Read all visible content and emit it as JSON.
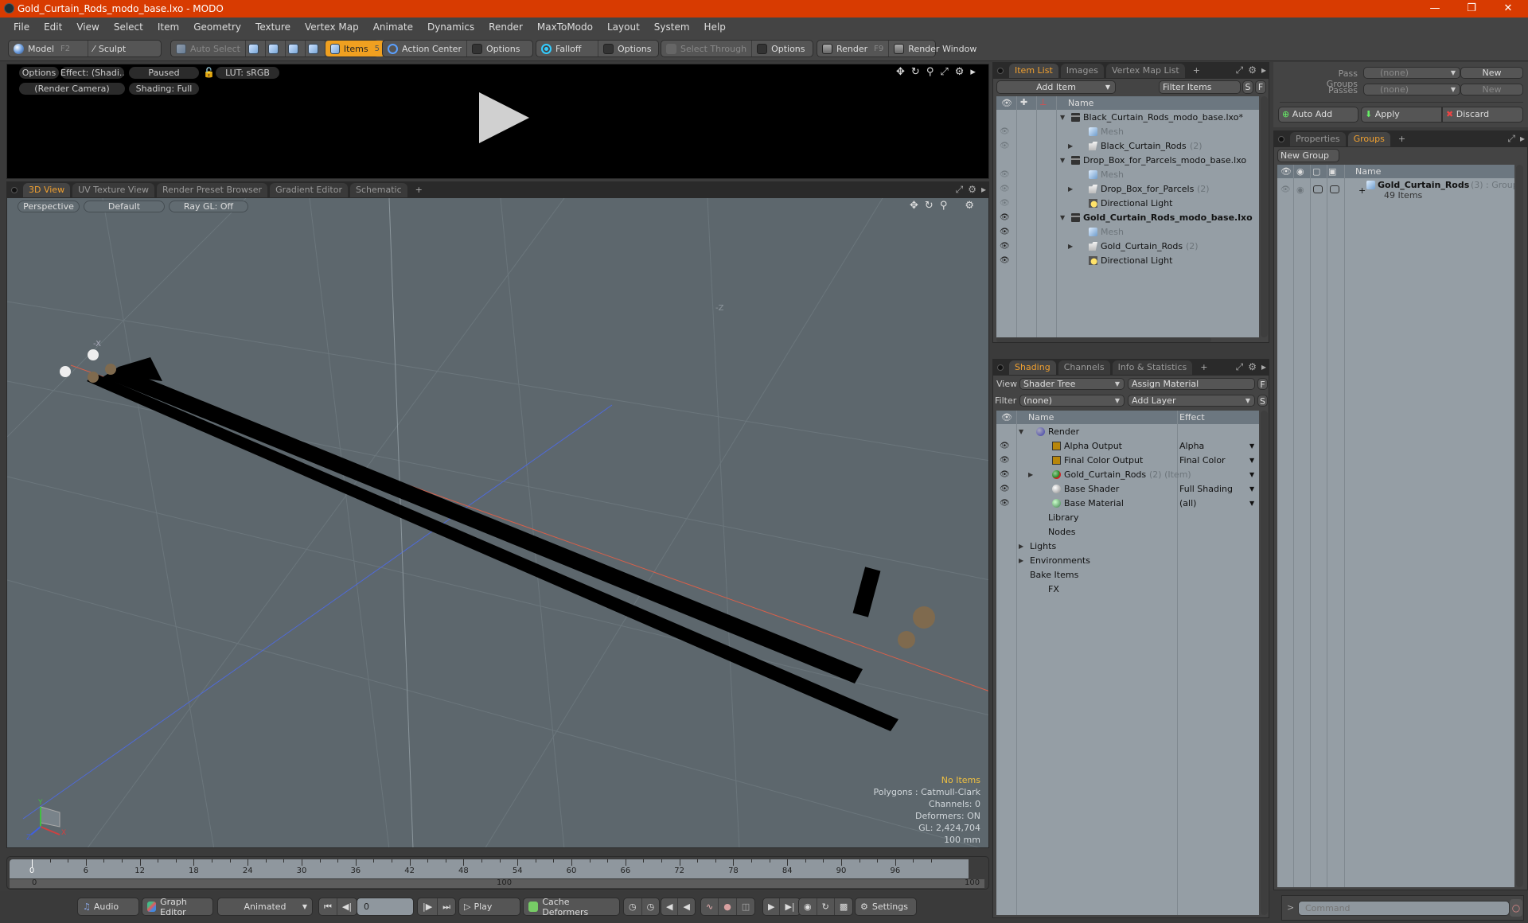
{
  "window": {
    "title": "Gold_Curtain_Rods_modo_base.lxo - MODO",
    "controls": [
      "minimize",
      "maximize",
      "close"
    ]
  },
  "menu": [
    "File",
    "Edit",
    "View",
    "Select",
    "Item",
    "Geometry",
    "Texture",
    "Vertex Map",
    "Animate",
    "Dynamics",
    "Render",
    "MaxToModo",
    "Layout",
    "System",
    "Help"
  ],
  "toolbar": {
    "model": "Model",
    "model_key": "F2",
    "sculpt": "Sculpt",
    "auto_select": "Auto Select",
    "items": "Items",
    "items_key": "5",
    "action_center": "Action Center",
    "options1": "Options",
    "falloff": "Falloff",
    "options2": "Options",
    "select_through": "Select Through",
    "options3": "Options",
    "render": "Render",
    "render_key": "F9",
    "render_window": "Render Window"
  },
  "preview": {
    "options": "Options",
    "effect": "Effect: (Shadi...",
    "paused": "Paused",
    "lut": "LUT: sRGB",
    "camera": "(Render Camera)",
    "shading": "Shading: Full"
  },
  "viewport_tabs": [
    "3D View",
    "UV Texture View",
    "Render Preset Browser",
    "Gradient Editor",
    "Schematic",
    "+"
  ],
  "viewport": {
    "projection": "Perspective",
    "style": "Default",
    "raygl": "Ray GL: Off",
    "axis_label_neg_x": "-X",
    "axis_label_neg_z": "-Z",
    "hud": {
      "selection": "No Items",
      "polygons": "Polygons : Catmull-Clark",
      "channels": "Channels: 0",
      "deformers": "Deformers: ON",
      "gl": "GL: 2,424,704",
      "scale": "100 mm"
    },
    "gizmo": {
      "x": "X",
      "y": "Y",
      "z": "Z"
    }
  },
  "timeline": {
    "ticks": [
      "0",
      "6",
      "12",
      "18",
      "24",
      "30",
      "36",
      "42",
      "48",
      "54",
      "60",
      "66",
      "72",
      "78",
      "84",
      "90",
      "96"
    ],
    "range_start": "0",
    "range_mid": "100",
    "range_end": "100",
    "current_frame": 0
  },
  "transport": {
    "audio": "Audio",
    "graph_editor": "Graph Editor",
    "mode": "Animated",
    "frame": "0",
    "play": "Play",
    "cache": "Cache Deformers",
    "settings": "Settings"
  },
  "item_list": {
    "tabs": [
      "Item List",
      "Images",
      "Vertex Map List",
      "+"
    ],
    "add_item": "Add Item",
    "filter": "Filter Items",
    "s": "S",
    "f": "F",
    "header": "Name",
    "rows": [
      {
        "label": "Black_Curtain_Rods_modo_base.lxo*",
        "type": "scene",
        "indent": 0,
        "eye": "",
        "bold": false
      },
      {
        "label": "Mesh",
        "type": "mesh",
        "indent": 1,
        "eye": "dim",
        "dim": true
      },
      {
        "label": "Black_Curtain_Rods",
        "count": "(2)",
        "type": "group",
        "indent": 1,
        "eye": "dim"
      },
      {
        "label": "Drop_Box_for_Parcels_modo_base.lxo",
        "type": "scene",
        "indent": 0,
        "eye": ""
      },
      {
        "label": "Mesh",
        "type": "mesh",
        "indent": 1,
        "eye": "dim",
        "dim": true
      },
      {
        "label": "Drop_Box_for_Parcels",
        "count": "(2)",
        "type": "group",
        "indent": 1,
        "eye": "dim"
      },
      {
        "label": "Directional Light",
        "type": "light",
        "indent": 1,
        "eye": "dim"
      },
      {
        "label": "Gold_Curtain_Rods_modo_base.lxo",
        "type": "scene",
        "indent": 0,
        "eye": "on",
        "bold": true
      },
      {
        "label": "Mesh",
        "type": "mesh",
        "indent": 1,
        "eye": "on",
        "dim": true
      },
      {
        "label": "Gold_Curtain_Rods",
        "count": "(2)",
        "type": "group",
        "indent": 1,
        "eye": "on"
      },
      {
        "label": "Directional Light",
        "type": "light",
        "indent": 1,
        "eye": "on"
      }
    ]
  },
  "shading": {
    "tabs": [
      "Shading",
      "Channels",
      "Info & Statistics",
      "+"
    ],
    "view_label": "View",
    "view_value": "Shader Tree",
    "assign": "Assign Material",
    "f": "F",
    "filter_label": "Filter",
    "filter_value": "(none)",
    "add_layer": "Add Layer",
    "s": "S",
    "col_name": "Name",
    "col_effect": "Effect",
    "rows": [
      {
        "label": "Render",
        "icon": "render-ball",
        "indent": 0,
        "effect": "",
        "eye": false
      },
      {
        "label": "Alpha Output",
        "icon": "output",
        "indent": 1,
        "effect": "Alpha",
        "eye": true
      },
      {
        "label": "Final Color Output",
        "icon": "output",
        "indent": 1,
        "effect": "Final Color",
        "eye": true
      },
      {
        "label": "Gold_Curtain_Rods",
        "suffix": "(2) (Item)",
        "icon": "material-mask",
        "indent": 1,
        "effect": "",
        "eye": true,
        "expand": true
      },
      {
        "label": "Base Shader",
        "icon": "shader-ball",
        "indent": 1,
        "effect": "Full Shading",
        "eye": true
      },
      {
        "label": "Base Material",
        "icon": "material-ball",
        "indent": 1,
        "effect": "(all)",
        "eye": true
      },
      {
        "label": "Library",
        "icon": "folder",
        "indent": 0,
        "effect": ""
      },
      {
        "label": "Nodes",
        "icon": "folder",
        "indent": 0,
        "effect": ""
      },
      {
        "label": "Lights",
        "icon": "",
        "indent": -1,
        "effect": "",
        "expand": true
      },
      {
        "label": "Environments",
        "icon": "",
        "indent": -1,
        "effect": "",
        "expand": true
      },
      {
        "label": "Bake Items",
        "icon": "",
        "indent": -1,
        "effect": ""
      },
      {
        "label": "FX",
        "icon": "clap",
        "indent": 0,
        "effect": ""
      }
    ]
  },
  "passes": {
    "pass_groups_label": "Pass Groups",
    "pass_groups_value": "(none)",
    "new1": "New",
    "passes_label": "Passes",
    "passes_value": "(none)",
    "new2": "New",
    "auto_add": "Auto Add",
    "apply": "Apply",
    "discard": "Discard"
  },
  "groups": {
    "tabs": [
      "Properties",
      "Groups",
      "+"
    ],
    "new_group": "New Group",
    "header": "Name",
    "rows": [
      {
        "label": "Gold_Curtain_Rods",
        "count": "(3)",
        "type": ": Group",
        "sub": "49 Items"
      }
    ]
  },
  "command": {
    "placeholder": "Command",
    "prompt": ">"
  },
  "colors": {
    "titlebar": "#d83b01",
    "accent": "#f0a030",
    "viewport_bg": "#5d676d",
    "tree_bg": "#959ea5"
  }
}
